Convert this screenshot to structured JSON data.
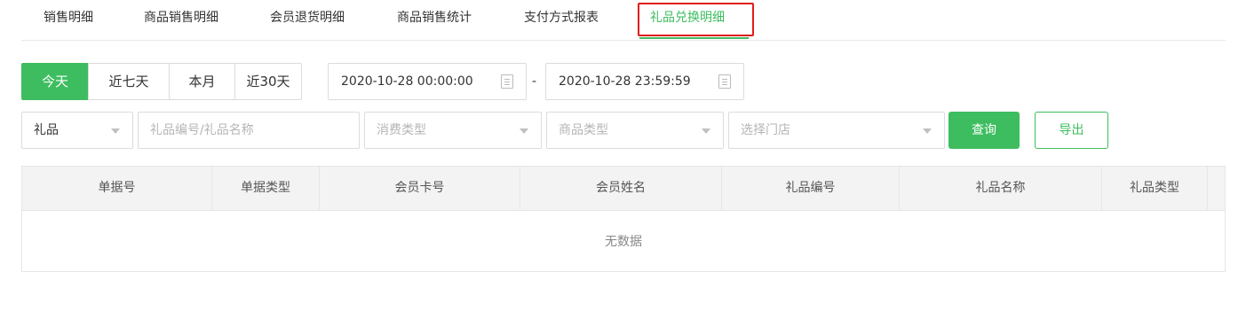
{
  "tabs": [
    {
      "label": "销售明细"
    },
    {
      "label": "商品销售明细"
    },
    {
      "label": "会员退货明细"
    },
    {
      "label": "商品销售统计"
    },
    {
      "label": "支付方式报表"
    },
    {
      "label": "礼品兑换明细",
      "active": true
    }
  ],
  "date_range_buttons": [
    {
      "label": "今天",
      "active": true
    },
    {
      "label": "近七天"
    },
    {
      "label": "本月"
    },
    {
      "label": "近30天"
    }
  ],
  "date_start": "2020-10-28 00:00:00",
  "date_separator": "-",
  "date_end": "2020-10-28 23:59:59",
  "filters": {
    "type_select": "礼品",
    "keyword_placeholder": "礼品编号/礼品名称",
    "consume_type_placeholder": "消费类型",
    "goods_type_placeholder": "商品类型",
    "store_placeholder": "选择门店"
  },
  "actions": {
    "query_label": "查询",
    "export_label": "导出"
  },
  "table": {
    "columns": [
      "单据号",
      "单据类型",
      "会员卡号",
      "会员姓名",
      "礼品编号",
      "礼品名称",
      "礼品类型"
    ],
    "rows": [],
    "empty_text": "无数据"
  },
  "colors": {
    "accent": "#3dbd5f",
    "highlight_box": "#e01c1c"
  }
}
